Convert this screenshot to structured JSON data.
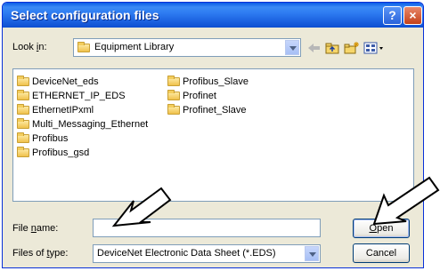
{
  "dialog": {
    "title": "Select configuration files",
    "help_button": "?",
    "close_button": "×"
  },
  "look_in": {
    "label_pre": "Look ",
    "label_mnemonic": "i",
    "label_post": "n:",
    "value": "Equipment Library"
  },
  "files": [
    "DeviceNet_eds",
    "ETHERNET_IP_EDS",
    "EthernetIPxml",
    "Multi_Messaging_Ethernet",
    "Profibus",
    "Profibus_gsd",
    "Profibus_Slave",
    "Profinet",
    "Profinet_Slave"
  ],
  "file_name": {
    "label_pre": "File ",
    "label_mnemonic": "n",
    "label_post": "ame:",
    "value": ""
  },
  "file_type": {
    "label_pre": "Files of ",
    "label_mnemonic": "t",
    "label_post": "ype:",
    "value": "DeviceNet Electronic Data Sheet (*.EDS)"
  },
  "buttons": {
    "open_mnemonic": "O",
    "open_rest": "pen",
    "cancel": "Cancel"
  },
  "colors": {
    "titlebar": "#2f7df2",
    "dialog_bg": "#ece9d8",
    "folder": "#f0c24b"
  }
}
